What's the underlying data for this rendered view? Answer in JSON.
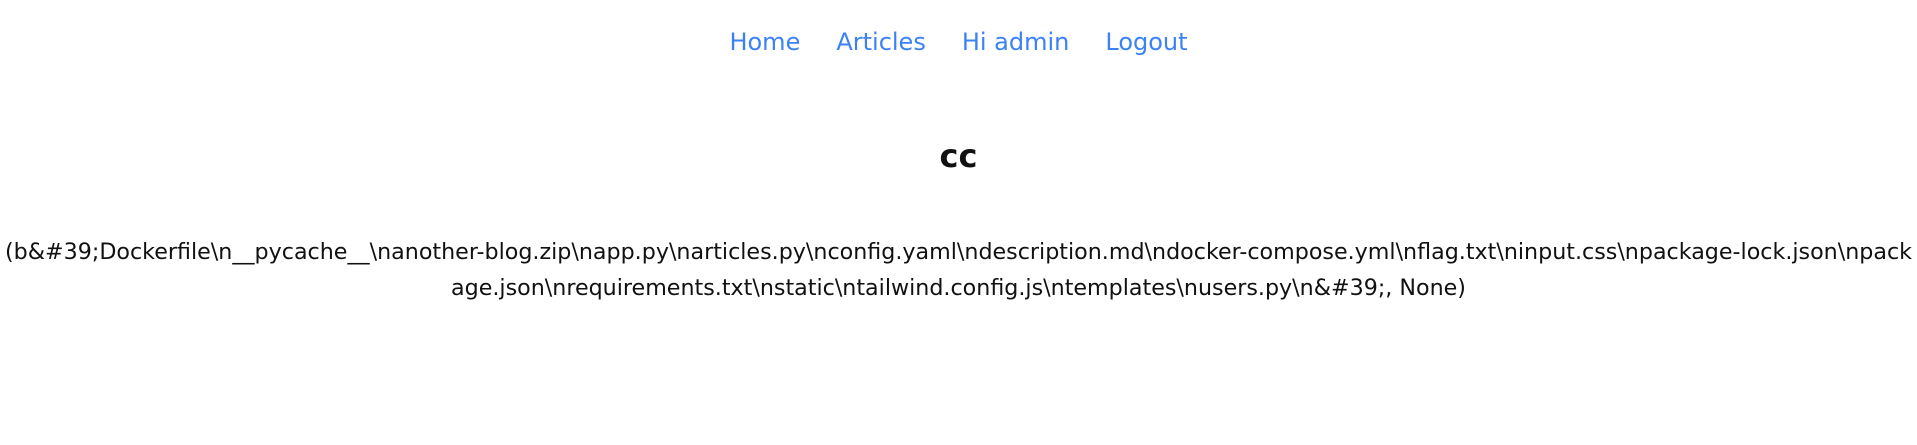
{
  "nav": {
    "items": [
      {
        "label": "Home"
      },
      {
        "label": "Articles"
      },
      {
        "label": "Hi admin"
      },
      {
        "label": "Logout"
      }
    ]
  },
  "article": {
    "title": "cc",
    "body": "(b&#39;Dockerfile\\n__pycache__\\nanother-blog.zip\\napp.py\\narticles.py\\nconfig.yaml\\ndescription.md\\ndocker-compose.yml\\nflag.txt\\ninput.css\\npackage-lock.json\\npackage.json\\nrequirements.txt\\nstatic\\ntailwind.config.js\\ntemplates\\nusers.py\\n&#39;, None)"
  },
  "colors": {
    "link": "#3b82f6",
    "text": "#111111",
    "background": "#ffffff"
  }
}
